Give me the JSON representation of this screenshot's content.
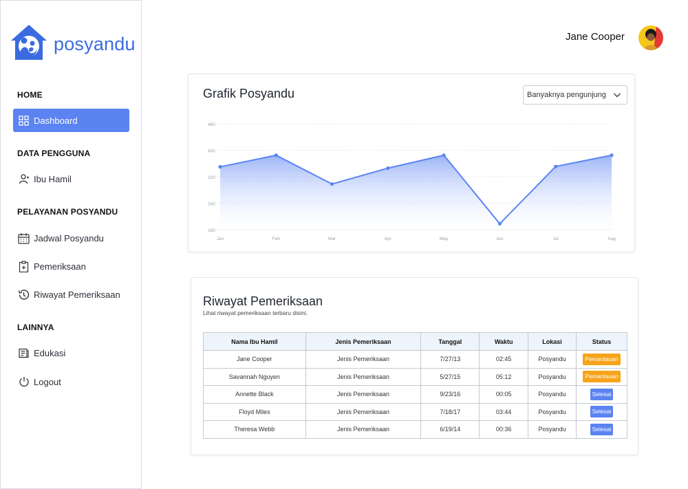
{
  "brand": {
    "name": "posyandu",
    "color": "#3a6be0"
  },
  "colors": {
    "accent": "#5b83f2",
    "warning": "#f6a41b",
    "header_bg": "#eef4fb"
  },
  "sidebar": {
    "sections": {
      "home": "HOME",
      "data_pengguna": "DATA PENGGUNA",
      "pelayanan": "PELAYANAN POSYANDU",
      "lainnya": "LAINNYA"
    },
    "items": {
      "dashboard": {
        "label": "Dashboard",
        "icon": "dashboard-grid-icon",
        "active": true
      },
      "ibu_hamil": {
        "label": "Ibu Hamil",
        "icon": "user-icon"
      },
      "jadwal": {
        "label": "Jadwal Posyandu",
        "icon": "calendar-icon"
      },
      "pemeriksaan": {
        "label": "Pemeriksaan",
        "icon": "clipboard-plus-icon"
      },
      "riwayat": {
        "label": "Riwayat Pemeriksaan",
        "icon": "history-icon"
      },
      "edukasi": {
        "label": "Edukasi",
        "icon": "document-icon"
      },
      "logout": {
        "label": "Logout",
        "icon": "power-icon"
      }
    }
  },
  "header": {
    "user_name": "Jane Cooper",
    "avatar_icon": "user-avatar"
  },
  "chart_card": {
    "title": "Grafik Posyandu",
    "dropdown_value": "Banyaknya pengunjung"
  },
  "chart_data": {
    "type": "area",
    "x": [
      "Jan",
      "Feb",
      "Mar",
      "Apr",
      "May",
      "Jun",
      "Jul",
      "Aug"
    ],
    "series": [
      {
        "values": [
          350,
          385,
          298,
          346,
          385,
          178,
          351,
          385
        ]
      }
    ],
    "yticks": [
      160,
      240,
      320,
      400,
      480
    ],
    "ylim": [
      160,
      480
    ],
    "grid": true,
    "color": "#5b83f2"
  },
  "history": {
    "title": "Riwayat Pemeriksaan",
    "subtitle": "Lihat riwayat pemeriksaan terbaru disini.",
    "columns": [
      "Nama Ibu Hamil",
      "Jenis Pemeriksaan",
      "Tanggal",
      "Waktu",
      "Lokasi",
      "Status"
    ],
    "rows": [
      {
        "name": "Jane Cooper",
        "type": "Jenis Pemeriksaan",
        "date": "7/27/13",
        "time": "02:45",
        "location": "Posyandu",
        "status": "Pemantauan",
        "status_color": "orange"
      },
      {
        "name": "Savannah Nguyen",
        "type": "Jenis Pemeriksaan",
        "date": "5/27/15",
        "time": "05:12",
        "location": "Posyandu",
        "status": "Pemantauan",
        "status_color": "orange"
      },
      {
        "name": "Annette Black",
        "type": "Jenis Pemeriksaan",
        "date": "9/23/16",
        "time": "00:05",
        "location": "Posyandu",
        "status": "Selesai",
        "status_color": "blue"
      },
      {
        "name": "Floyd Miles",
        "type": "Jenis Pemeriksaan",
        "date": "7/18/17",
        "time": "03:44",
        "location": "Posyandu",
        "status": "Selesai",
        "status_color": "blue"
      },
      {
        "name": "Theresa Webb",
        "type": "Jenis Pemeriksaan",
        "date": "6/19/14",
        "time": "00:36",
        "location": "Posyandu",
        "status": "Selesai",
        "status_color": "blue"
      }
    ]
  }
}
